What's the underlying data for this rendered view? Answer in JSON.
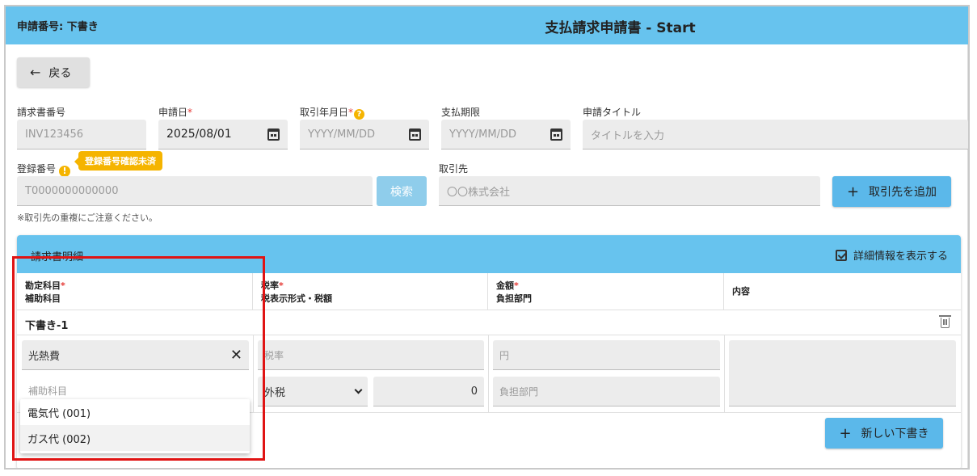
{
  "header": {
    "app_no_label": "申請番号: 下書き",
    "title": "支払請求申請書 - Start"
  },
  "back": {
    "label": "戻る"
  },
  "fields": {
    "invoice_no": {
      "label": "請求書番号",
      "value": "INV123456"
    },
    "apply_date": {
      "label": "申請日",
      "value": "2025/08/01"
    },
    "trade_date": {
      "label": "取引年月日",
      "placeholder": "YYYY/MM/DD"
    },
    "due_date": {
      "label": "支払期限",
      "placeholder": "YYYY/MM/DD"
    },
    "apply_title": {
      "label": "申請タイトル",
      "placeholder": "タイトルを入力"
    },
    "reg_no": {
      "label": "登録番号",
      "placeholder": "T0000000000000",
      "badge": "登録番号確認未済"
    },
    "partner": {
      "label": "取引先",
      "placeholder": "〇〇株式会社"
    }
  },
  "buttons": {
    "search": "検索",
    "add_partner": "取引先を追加",
    "new_draft": "新しい下書き"
  },
  "note": "※取引先の重複にご注意ください。",
  "detail": {
    "title": "請求書明細",
    "show_detail": "詳細情報を表示する",
    "columns": [
      {
        "line1": "勘定科目",
        "line2": "補助科目",
        "required": true
      },
      {
        "line1": "税率",
        "line2": "税表示形式・税額",
        "required": true
      },
      {
        "line1": "金額",
        "line2": "負担部門",
        "required": true
      },
      {
        "line1": "内容",
        "line2": "",
        "required": false
      }
    ],
    "row": {
      "title": "下書き-1",
      "account": "光熱費",
      "sub_account_placeholder": "補助科目",
      "tax_rate_placeholder": "税率",
      "tax_mode": "外税",
      "tax_amount": "0",
      "amount_placeholder": "円",
      "department_placeholder": "負担部門"
    }
  },
  "dropdown": {
    "options": [
      "電気代 (001)",
      "ガス代 (002)"
    ]
  },
  "req_mark": "*",
  "help_mark": "?",
  "warn_mark": "!",
  "colors": {
    "header": "#67c3ee",
    "button": "#5bb8ea",
    "warning": "#f5b400",
    "highlight": "#e01414"
  }
}
